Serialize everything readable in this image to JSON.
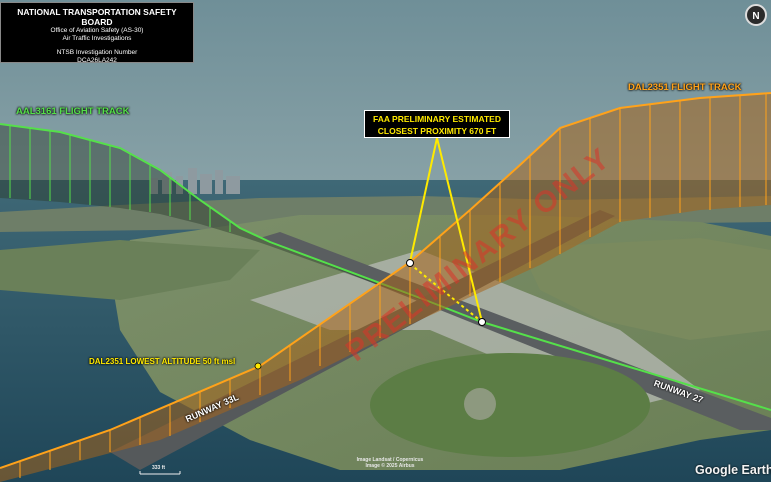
{
  "header": {
    "agency": "NATIONAL TRANSPORTATION SAFETY BOARD",
    "office": "Office of Aviation Safety (AS-30)",
    "division": "Air Traffic Investigations",
    "investigation_label": "NTSB Investigation Number",
    "investigation_number": "DCA26LA242"
  },
  "tracks": {
    "aal": "AAL3161 FLIGHT TRACK",
    "dal": "DAL2351 FLIGHT TRACK",
    "aal_color": "#55e04a",
    "dal_color": "#ffa21a"
  },
  "callout": {
    "line1": "FAA PRELIMINARY ESTIMATED",
    "line2": "CLOSEST PROXIMITY 670 FT"
  },
  "labels": {
    "lowest_altitude": "DAL2351 LOWEST ALTITUDE 50 ft msl",
    "runway_33l": "RUNWAY 33L",
    "runway_27": "RUNWAY 27",
    "watermark": "PRELIMINARY ONLY"
  },
  "map": {
    "attribution_1": "Image Landsat / Copernicus",
    "attribution_2": "Image © 2025 Airbus",
    "brand": "Google Earth",
    "scale": "333 ft",
    "compass": "N"
  }
}
